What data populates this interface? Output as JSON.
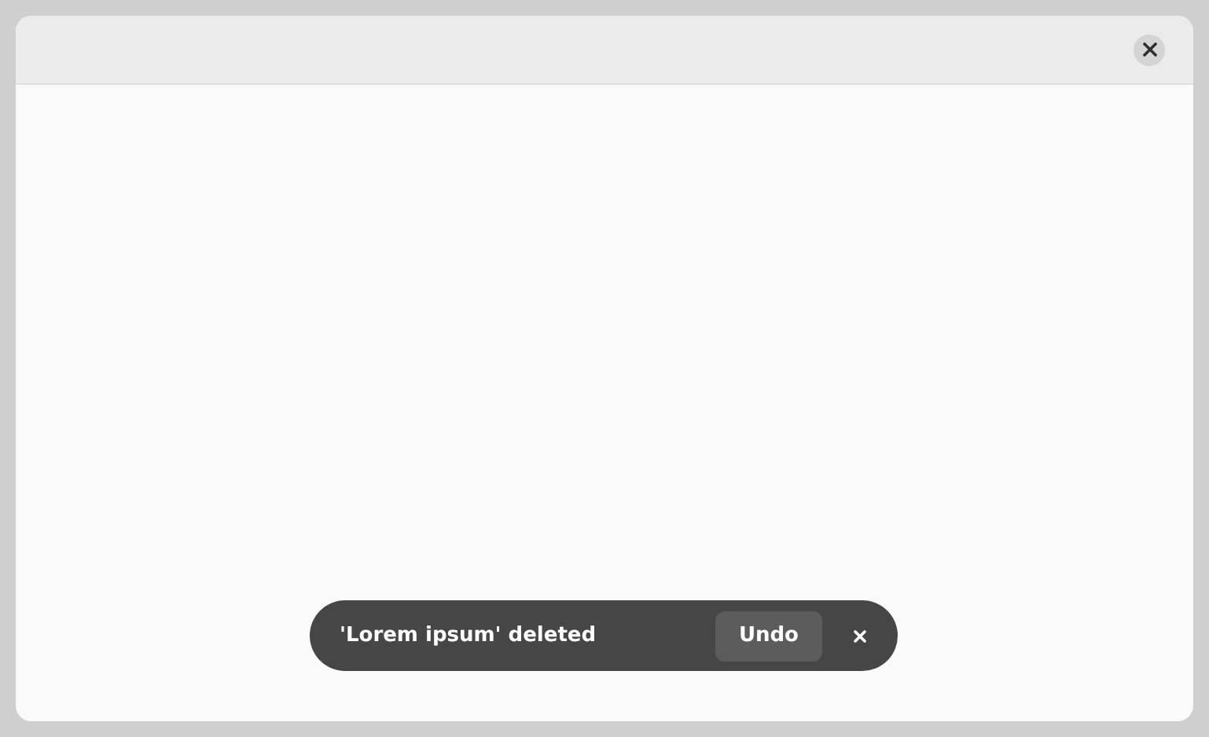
{
  "toast": {
    "message": "'Lorem ipsum' deleted",
    "action": "Undo"
  }
}
